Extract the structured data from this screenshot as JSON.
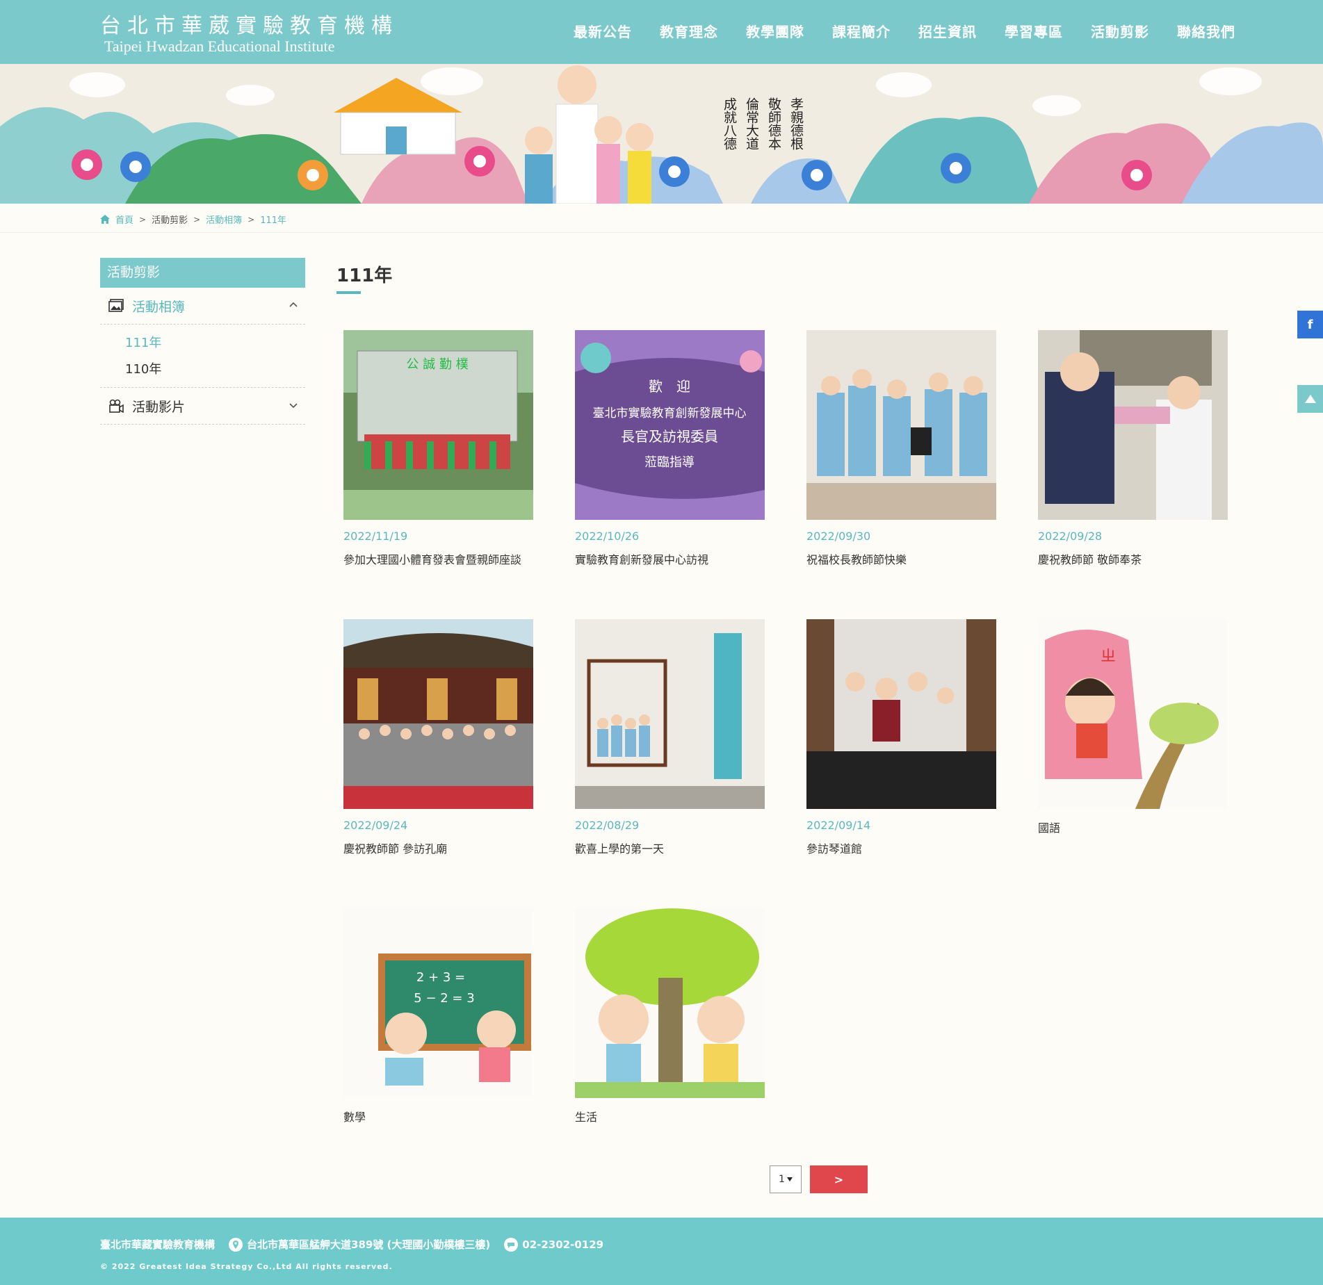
{
  "header": {
    "logo_cn": "台北市華葳實驗教育機構",
    "logo_en": "Taipei Hwadzan Educational Institute",
    "nav": [
      "最新公告",
      "教育理念",
      "教學團隊",
      "課程簡介",
      "招生資訊",
      "學習專區",
      "活動剪影",
      "聯絡我們"
    ]
  },
  "banner": {
    "calligraphy": [
      "孝親德根",
      "敬師德本",
      "倫常大道",
      "成就八德"
    ]
  },
  "breadcrumb": {
    "home": "首頁",
    "level1": "活動剪影",
    "level2": "活動相簿",
    "current": "111年"
  },
  "sidebar": {
    "title": "活動剪影",
    "album_label": "活動相簿",
    "years": [
      "111年",
      "110年"
    ],
    "video_label": "活動影片"
  },
  "main": {
    "title": "111年",
    "cards": [
      {
        "date": "2022/11/19",
        "caption": "參加大理國小體育發表會暨親師座談",
        "thumb_text": "公 誠 勤 樸"
      },
      {
        "date": "2022/10/26",
        "caption": "實驗教育創新發展中心訪視",
        "thumb_lines": [
          "歡　迎",
          "臺北市實驗教育創新發展中心",
          "長官及訪視委員",
          "蒞臨指導"
        ]
      },
      {
        "date": "2022/09/30",
        "caption": "祝福校長教師節快樂"
      },
      {
        "date": "2022/09/28",
        "caption": "慶祝教師節 敬師奉茶"
      },
      {
        "date": "2022/09/24",
        "caption": "慶祝教師節 參訪孔廟"
      },
      {
        "date": "2022/08/29",
        "caption": "歡喜上學的第一天"
      },
      {
        "date": "2022/09/14",
        "caption": "參訪琴道館"
      },
      {
        "date": "",
        "caption": "國語"
      },
      {
        "date": "",
        "caption": "數學",
        "thumb_lines": [
          "2 + 3 =",
          "5 − 2 = 3"
        ]
      },
      {
        "date": "",
        "caption": "生活"
      }
    ]
  },
  "pagination": {
    "page": "1",
    "next": ">"
  },
  "floating": {
    "facebook": "f"
  },
  "footer": {
    "name": "臺北市華藏實驗教育機構",
    "address": "台北市萬華區艋舺大道389號 (大理國小勤樸樓三樓)",
    "phone": "02-2302-0129",
    "copyright": "© 2022 Greatest Idea Strategy Co.,Ltd All rights reserved."
  },
  "colors": {
    "teal": "#7cc9cc",
    "accent": "#59b8bf",
    "red": "#e0474c",
    "footer": "#6fcbcb"
  }
}
